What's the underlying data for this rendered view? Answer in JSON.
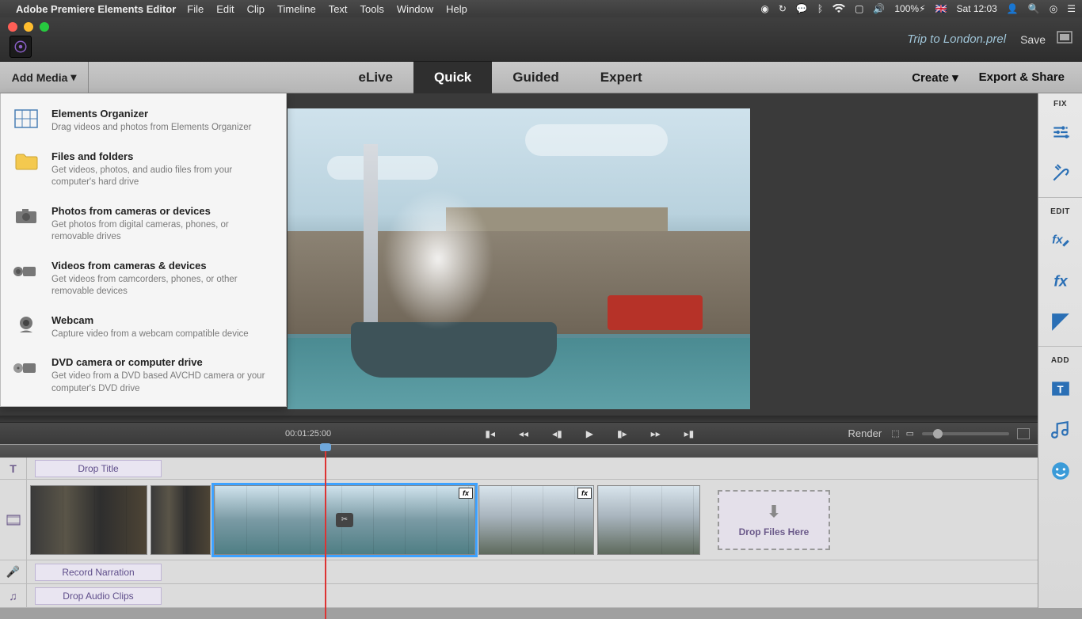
{
  "menubar": {
    "app_name": "Adobe Premiere Elements Editor",
    "items": [
      "File",
      "Edit",
      "Clip",
      "Timeline",
      "Text",
      "Tools",
      "Window",
      "Help"
    ],
    "battery": "100%",
    "flag": "🇬🇧",
    "clock": "Sat 12:03"
  },
  "titlebar": {
    "filename": "Trip to London.prel",
    "save": "Save"
  },
  "modebar": {
    "add_media": "Add Media",
    "tabs": [
      "eLive",
      "Quick",
      "Guided",
      "Expert"
    ],
    "active_tab": "Quick",
    "create": "Create",
    "export": "Export & Share"
  },
  "add_media_menu": [
    {
      "title": "Elements Organizer",
      "desc": "Drag videos and photos from Elements Organizer",
      "icon": "organizer"
    },
    {
      "title": "Files and folders",
      "desc": "Get videos, photos, and audio files from your computer's hard drive",
      "icon": "folder"
    },
    {
      "title": "Photos from cameras or devices",
      "desc": "Get photos from digital cameras, phones, or removable drives",
      "icon": "camera"
    },
    {
      "title": "Videos from cameras & devices",
      "desc": "Get videos from camcorders, phones, or other removable devices",
      "icon": "camcorder"
    },
    {
      "title": "Webcam",
      "desc": "Capture video from a webcam compatible device",
      "icon": "webcam"
    },
    {
      "title": "DVD camera or computer drive",
      "desc": "Get video from a DVD based AVCHD camera or your computer's DVD drive",
      "icon": "dvd"
    }
  ],
  "transport": {
    "timecode": "00:01:25:00",
    "render": "Render"
  },
  "timeline": {
    "drop_title": "Drop Title",
    "record_narration": "Record Narration",
    "drop_audio": "Drop Audio Clips",
    "drop_files": "Drop Files Here"
  },
  "rightpanel": {
    "fix": "FIX",
    "edit": "EDIT",
    "add": "ADD"
  }
}
